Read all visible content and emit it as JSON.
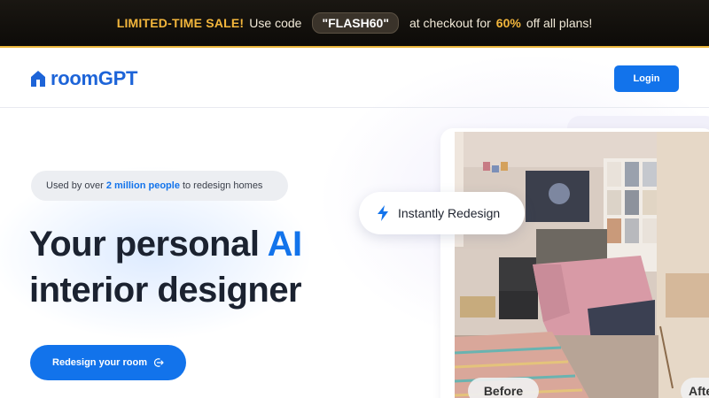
{
  "promo": {
    "sale_label": "LIMITED-TIME SALE!",
    "text_before_code": "Use code",
    "code": "\"FLASH60\"",
    "text_after_code": "at checkout for",
    "percent": "60%",
    "text_end": "off all plans!"
  },
  "header": {
    "logo_text": "roomGPT",
    "logo_icon": "house-icon",
    "login_label": "Login"
  },
  "hero": {
    "usedby_prefix": "Used by over",
    "usedby_highlight": "2 million people",
    "usedby_suffix": "to redesign homes",
    "headline_part1": "Your personal",
    "headline_ai": "AI",
    "headline_part2": "interior designer",
    "cta_label": "Redesign your room",
    "cta_icon": "arrow-right-circle-icon"
  },
  "preview": {
    "chip_label": "Instantly Redesign",
    "chip_icon": "lightning-bolt-icon",
    "before_label": "Before",
    "after_label": "After"
  },
  "colors": {
    "accent": "#1273eb",
    "promo_gold": "#f3b63c",
    "promo_bg": "#0d0b08",
    "heading": "#1b2230"
  }
}
